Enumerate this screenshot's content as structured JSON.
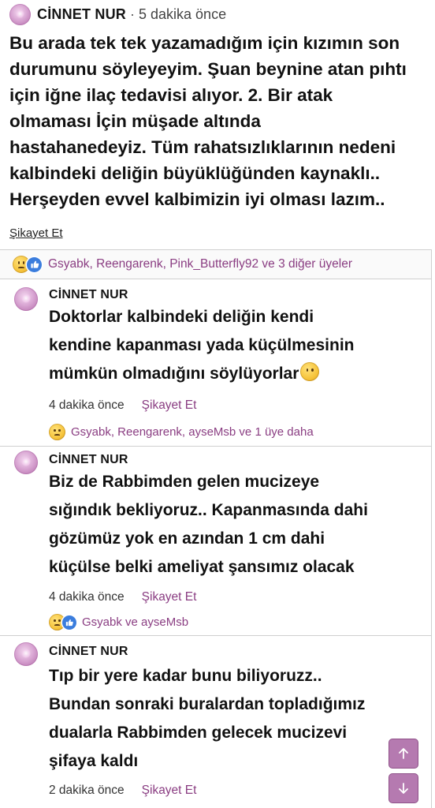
{
  "post": {
    "author": "CİNNET NUR",
    "separator": "·",
    "time": "5 dakika önce",
    "body": "Bu arada tek tek yazamadığım için kızımın son\ndurumunu söyleyeyim. Şuan beynine atan pıhtı\niçin iğne ilaç tedavisi alıyor. 2. Bir atak\nolmaması İçin müşade altında\nhastahanedeyiz. Tüm rahatsızlıklarının nedeni\nkalbindeki deliğin büyüklüğünden kaynaklı..\nHerşeyden evvel kalbimizin iyi olması lazım..",
    "report": "Şikayet Et",
    "reactions": {
      "icons": [
        "sad-emoji",
        "like"
      ],
      "text": "Gsyabk, Reengarenk, Pink_Butterfly92 ve 3 diğer üyeler"
    }
  },
  "replies": [
    {
      "author": "CİNNET NUR",
      "body": "Doktorlar kalbindeki deliğin kendi\nkendine kapanması yada küçülmesinin\nmümkün olmadığını söylüyorlar",
      "time": "4 dakika önce",
      "report": "Şikayet Et",
      "reactions": {
        "icons": [
          "sad-emoji"
        ],
        "text": "Gsyabk, Reengarenk, ayseMsb ve 1 üye daha"
      }
    },
    {
      "author": "CİNNET NUR",
      "body": "Biz de Rabbimden gelen mucizeye\nsığındık bekliyoruz.. Kapanmasında dahi\ngözümüz yok en azından 1 cm dahi\nküçülse belki ameliyat şansımız olacak",
      "time": "4 dakika önce",
      "report": "Şikayet Et",
      "reactions": {
        "icons": [
          "sad-emoji",
          "like"
        ],
        "text": "Gsyabk ve ayseMsb"
      }
    },
    {
      "author": "CİNNET NUR",
      "body": "Tıp bir yere kadar bunu biliyoruzz..\nBundan sonraki buralardan topladığımız\ndualarla Rabbimden gelecek mucizevi\nşifaya kaldı",
      "time": "2 dakika önce",
      "report": "Şikayet Et"
    }
  ],
  "scroll": {
    "up_icon": "arrow-up-icon",
    "down_icon": "arrow-down-icon"
  },
  "colors": {
    "accent": "#8a3d82",
    "button": "#b57ab0"
  }
}
